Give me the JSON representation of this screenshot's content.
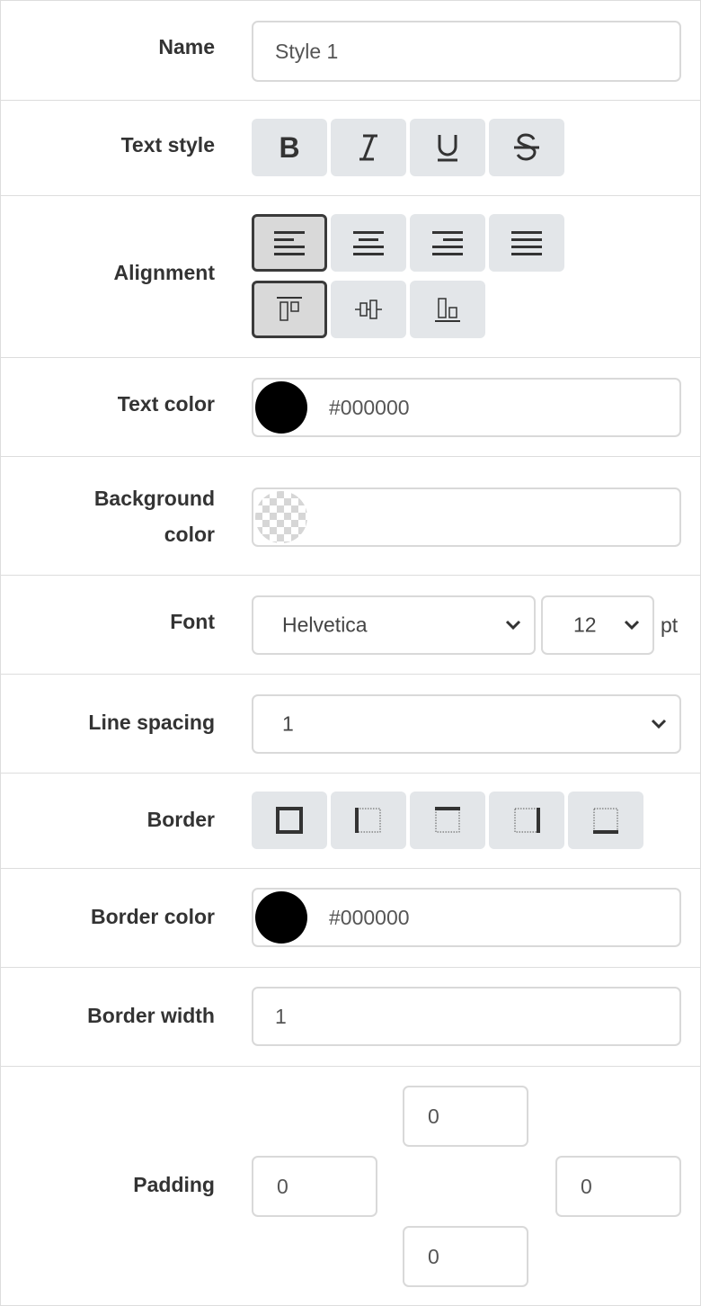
{
  "name": {
    "label": "Name",
    "value": "Style 1"
  },
  "text_style": {
    "label": "Text style",
    "buttons": [
      {
        "icon": "bold-icon"
      },
      {
        "icon": "italic-icon"
      },
      {
        "icon": "underline-icon"
      },
      {
        "icon": "strikethrough-icon"
      }
    ]
  },
  "alignment": {
    "label": "Alignment",
    "horizontal": [
      {
        "icon": "align-left-icon",
        "selected": true
      },
      {
        "icon": "align-center-icon",
        "selected": false
      },
      {
        "icon": "align-right-icon",
        "selected": false
      },
      {
        "icon": "align-justify-icon",
        "selected": false
      }
    ],
    "vertical": [
      {
        "icon": "valign-top-icon",
        "selected": true
      },
      {
        "icon": "valign-middle-icon",
        "selected": false
      },
      {
        "icon": "valign-bottom-icon",
        "selected": false
      }
    ]
  },
  "text_color": {
    "label": "Text color",
    "value": "#000000",
    "swatch": "#000000"
  },
  "background_color": {
    "label_line1": "Background",
    "label_line2": "color",
    "value": "",
    "swatch": "transparent"
  },
  "font": {
    "label": "Font",
    "family": "Helvetica",
    "size": "12",
    "unit": "pt"
  },
  "line_spacing": {
    "label": "Line spacing",
    "value": "1"
  },
  "border": {
    "label": "Border",
    "buttons": [
      {
        "icon": "border-all-icon"
      },
      {
        "icon": "border-left-icon"
      },
      {
        "icon": "border-top-icon"
      },
      {
        "icon": "border-right-icon"
      },
      {
        "icon": "border-bottom-icon"
      }
    ]
  },
  "border_color": {
    "label": "Border color",
    "value": "#000000",
    "swatch": "#000000"
  },
  "border_width": {
    "label": "Border width",
    "value": "1"
  },
  "padding": {
    "label": "Padding",
    "top": "0",
    "left": "0",
    "right": "0",
    "bottom": "0"
  }
}
